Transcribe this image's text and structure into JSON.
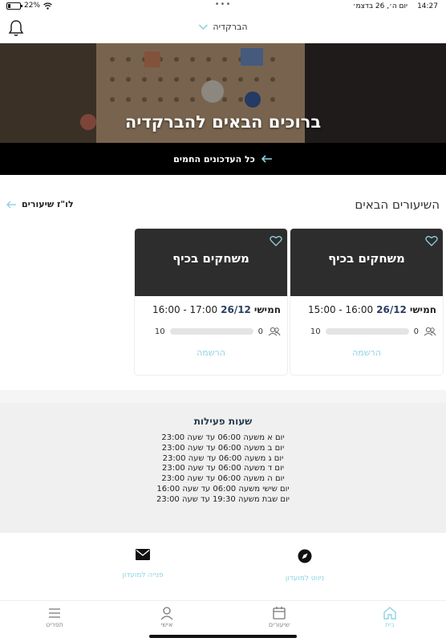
{
  "status_bar": {
    "time": "14:27",
    "date": "יום ה׳, 26 בדצמ׳",
    "battery": "22%",
    "battery_level": 0.22
  },
  "header": {
    "club_name": "הברקדיה"
  },
  "hero": {
    "title": "ברוכים הבאים להברקדיה"
  },
  "updates": {
    "label": "כל העדכונים החמים"
  },
  "lessons": {
    "title": "השיעורים הבאים",
    "schedule_link": "לו\"ז שיעורים",
    "cards": [
      {
        "name": "משחקים בכיף",
        "day": "חמישי",
        "date": "26/12",
        "hours": "15:00 - 16:00",
        "registered": "0",
        "capacity": "10",
        "register_label": "הרשמה"
      },
      {
        "name": "משחקים בכיף",
        "day": "חמישי",
        "date": "26/12",
        "hours": "16:00 - 17:00",
        "registered": "0",
        "capacity": "10",
        "register_label": "הרשמה"
      }
    ]
  },
  "hours": {
    "title": "שעות פעילות",
    "lines": [
      "יום א משעה 06:00  עד שעה 23:00",
      "יום ב משעה 06:00  עד שעה 23:00",
      "יום ג משעה 06:00  עד שעה 23:00",
      "יום ד משעה 06:00  עד שעה 23:00",
      "יום ה משעה 06:00  עד שעה 23:00",
      "יום שישי משעה 06:00  עד שעה 16:00",
      "יום שבת משעה 19:30  עד שעה 23:00"
    ]
  },
  "actions": {
    "navigate_label": "ניווט למועדון",
    "contact_label": "פנייה למועדון"
  },
  "tabs": {
    "home": "בית",
    "lessons": "שיעורים",
    "personal": "אישי",
    "menu": "תפריט"
  },
  "colors": {
    "accent": "#8fd3e2",
    "dark": "#2d2d2d",
    "black": "#000000"
  }
}
